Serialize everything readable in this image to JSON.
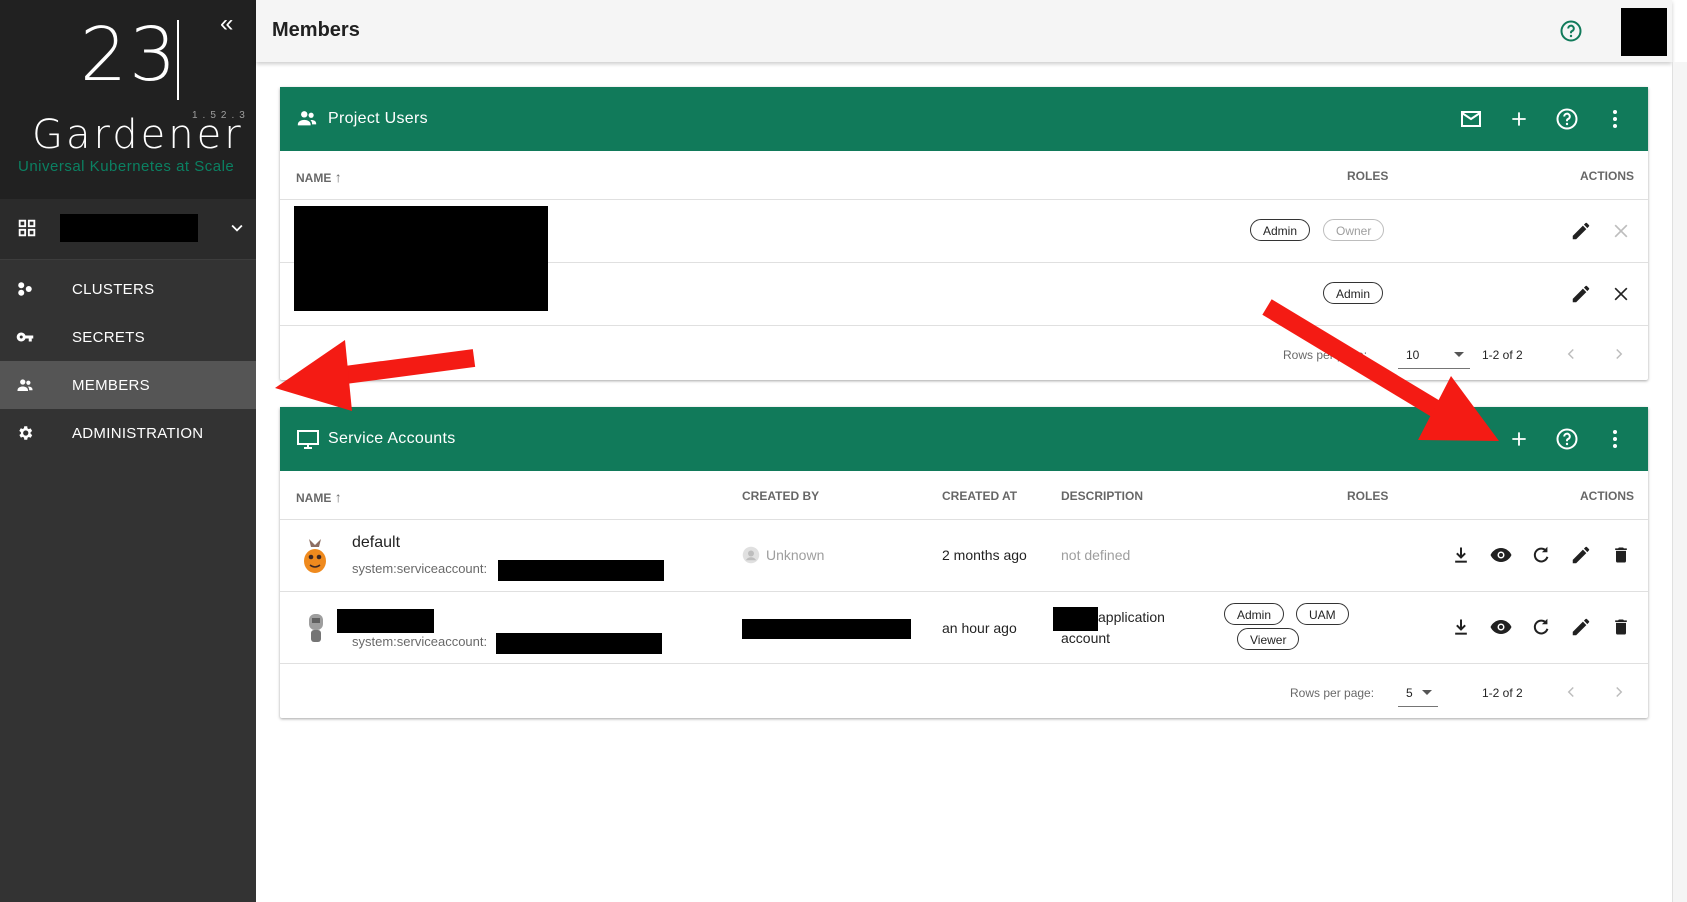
{
  "sidebar": {
    "logo_number": "23",
    "app_name": "Gardener",
    "version": "1.52.3",
    "tagline": "Universal Kubernetes at Scale",
    "nav": [
      {
        "label": "CLUSTERS",
        "icon": "clusters-icon"
      },
      {
        "label": "SECRETS",
        "icon": "key-icon"
      },
      {
        "label": "MEMBERS",
        "icon": "members-icon",
        "active": true
      },
      {
        "label": "ADMINISTRATION",
        "icon": "gear-icon"
      }
    ]
  },
  "header": {
    "title": "Members"
  },
  "project_users": {
    "title": "Project Users",
    "columns": {
      "name": "NAME",
      "roles": "ROLES",
      "actions": "ACTIONS"
    },
    "rows": [
      {
        "roles": [
          "Admin",
          "Owner"
        ],
        "owner_disabled": true,
        "delete_disabled": true
      },
      {
        "roles": [
          "Admin"
        ],
        "delete_disabled": false
      }
    ],
    "footer": {
      "rows_per_page_label": "Rows per page:",
      "rows_per_page": "10",
      "range": "1-2 of 2"
    }
  },
  "service_accounts": {
    "title": "Service Accounts",
    "columns": {
      "name": "NAME",
      "created_by": "CREATED BY",
      "created_at": "CREATED AT",
      "description": "DESCRIPTION",
      "roles": "ROLES",
      "actions": "ACTIONS"
    },
    "rows": [
      {
        "name": "default",
        "subtitle": "system:serviceaccount:",
        "created_by": "Unknown",
        "created_at": "2 months ago",
        "description": "not defined",
        "roles": []
      },
      {
        "name": "",
        "subtitle": "system:serviceaccount:",
        "created_by": "",
        "created_at": "an hour ago",
        "description_line1": "application",
        "description_line2": "account",
        "roles": [
          "Admin",
          "UAM",
          "Viewer"
        ]
      }
    ],
    "footer": {
      "rows_per_page_label": "Rows per page:",
      "rows_per_page": "5",
      "range": "1-2 of 2"
    }
  },
  "colors": {
    "brand_green": "#117a5a",
    "sidebar_bg": "#333333",
    "annotation_red": "#f41b14"
  }
}
